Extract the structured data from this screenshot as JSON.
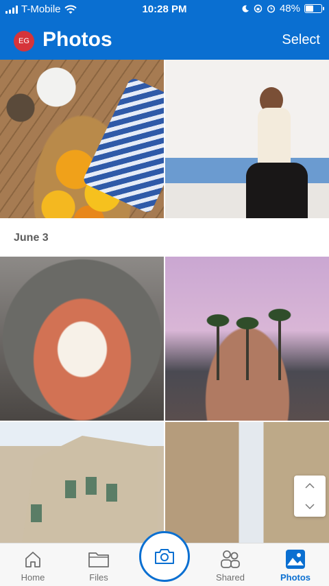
{
  "status_bar": {
    "carrier": "T-Mobile",
    "time": "10:28 PM",
    "battery": "48%",
    "battery_level": 0.48
  },
  "header": {
    "avatar_initials": "EG",
    "title": "Photos",
    "select_label": "Select"
  },
  "sections": [
    {
      "date_label": "June 3"
    }
  ],
  "tabs": [
    {
      "label": "Home",
      "icon": "home-icon"
    },
    {
      "label": "Files",
      "icon": "folder-icon"
    },
    {
      "label": "Shared",
      "icon": "people-icon"
    },
    {
      "label": "Photos",
      "icon": "photos-icon",
      "active": true
    }
  ],
  "camera": {
    "icon": "camera-icon"
  },
  "colors": {
    "accent": "#0a6fd1",
    "avatar": "#d6343a"
  }
}
